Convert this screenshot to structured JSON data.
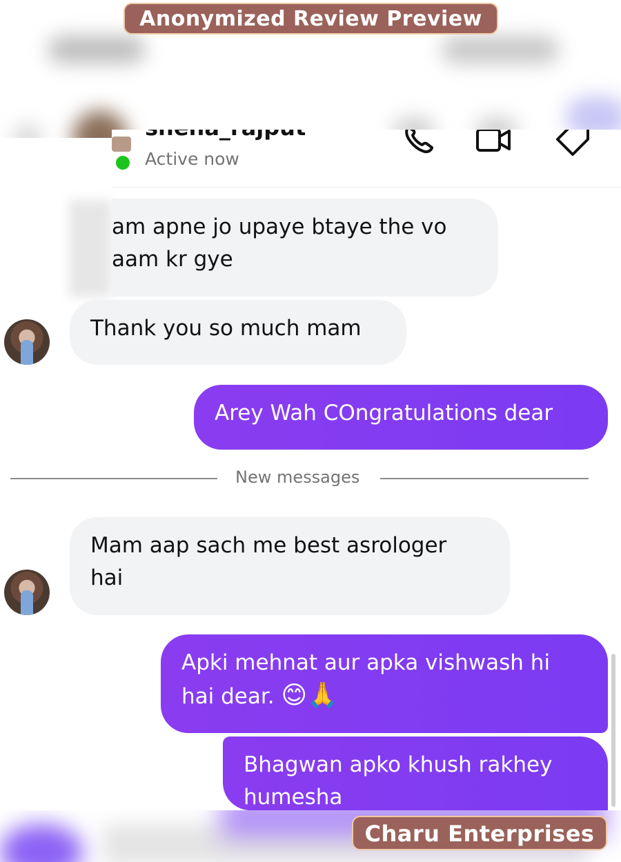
{
  "overlay": {
    "top_label": "Anonymized Review Preview",
    "bottom_label": "Charu Enterprises"
  },
  "header": {
    "username": "sheha_rajput",
    "status": "Active now",
    "icons": [
      "phone-icon",
      "video-camera-icon",
      "tag-icon"
    ],
    "status_color": "#1ec41e"
  },
  "messages": [
    {
      "direction": "incoming",
      "text": "am apne jo upaye btaye the vo\naam kr gye"
    },
    {
      "direction": "incoming",
      "text": "Thank you so much mam"
    },
    {
      "direction": "outgoing",
      "text": "Arey Wah COngratulations dear"
    },
    {
      "direction": "incoming",
      "text": "Mam aap sach me best asrologer\nhai"
    },
    {
      "direction": "outgoing",
      "text": "Apki mehnat aur apka vishwash hi\nhai dear.",
      "emojis": "😊🙏"
    },
    {
      "direction": "outgoing",
      "text": "Bhagwan apko khush rakhey\nhumesha"
    }
  ],
  "divider": {
    "label": "New messages"
  },
  "colors": {
    "outgoing_bubble": "#8a3cf0",
    "incoming_bubble": "#f2f3f5",
    "overlay_bg": "#9a625a"
  }
}
